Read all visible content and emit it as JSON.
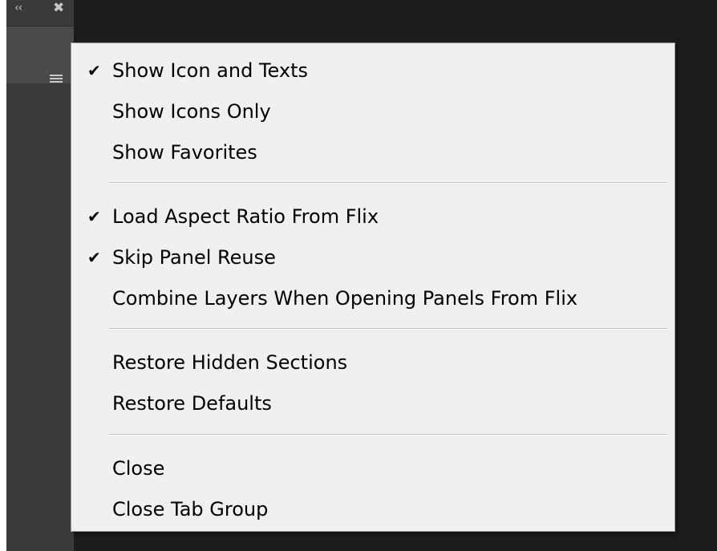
{
  "panel": {
    "collapse_glyph": "‹‹",
    "close_glyph": "✖",
    "icons": {
      "collapse": "double-chevron-left-icon",
      "close": "close-x-icon",
      "menu": "hamburger-menu-icon"
    }
  },
  "menu": {
    "groups": [
      {
        "items": [
          {
            "label": "Show Icon and Texts",
            "checked": true
          },
          {
            "label": "Show Icons Only",
            "checked": false
          },
          {
            "label": "Show Favorites",
            "checked": false
          }
        ]
      },
      {
        "items": [
          {
            "label": "Load Aspect Ratio From Flix",
            "checked": true
          },
          {
            "label": "Skip Panel Reuse",
            "checked": true
          },
          {
            "label": "Combine Layers When Opening Panels From Flix",
            "checked": false
          }
        ]
      },
      {
        "items": [
          {
            "label": "Restore Hidden Sections",
            "checked": false
          },
          {
            "label": "Restore Defaults",
            "checked": false
          }
        ]
      },
      {
        "items": [
          {
            "label": "Close",
            "checked": false
          },
          {
            "label": "Close Tab Group",
            "checked": false
          }
        ]
      }
    ],
    "check_glyph": "✔"
  },
  "colors": {
    "menu_background": "#f0f0f0",
    "panel_dark": "#1c1c1c",
    "panel_header": "#4a4a4a",
    "text": "#000000"
  }
}
